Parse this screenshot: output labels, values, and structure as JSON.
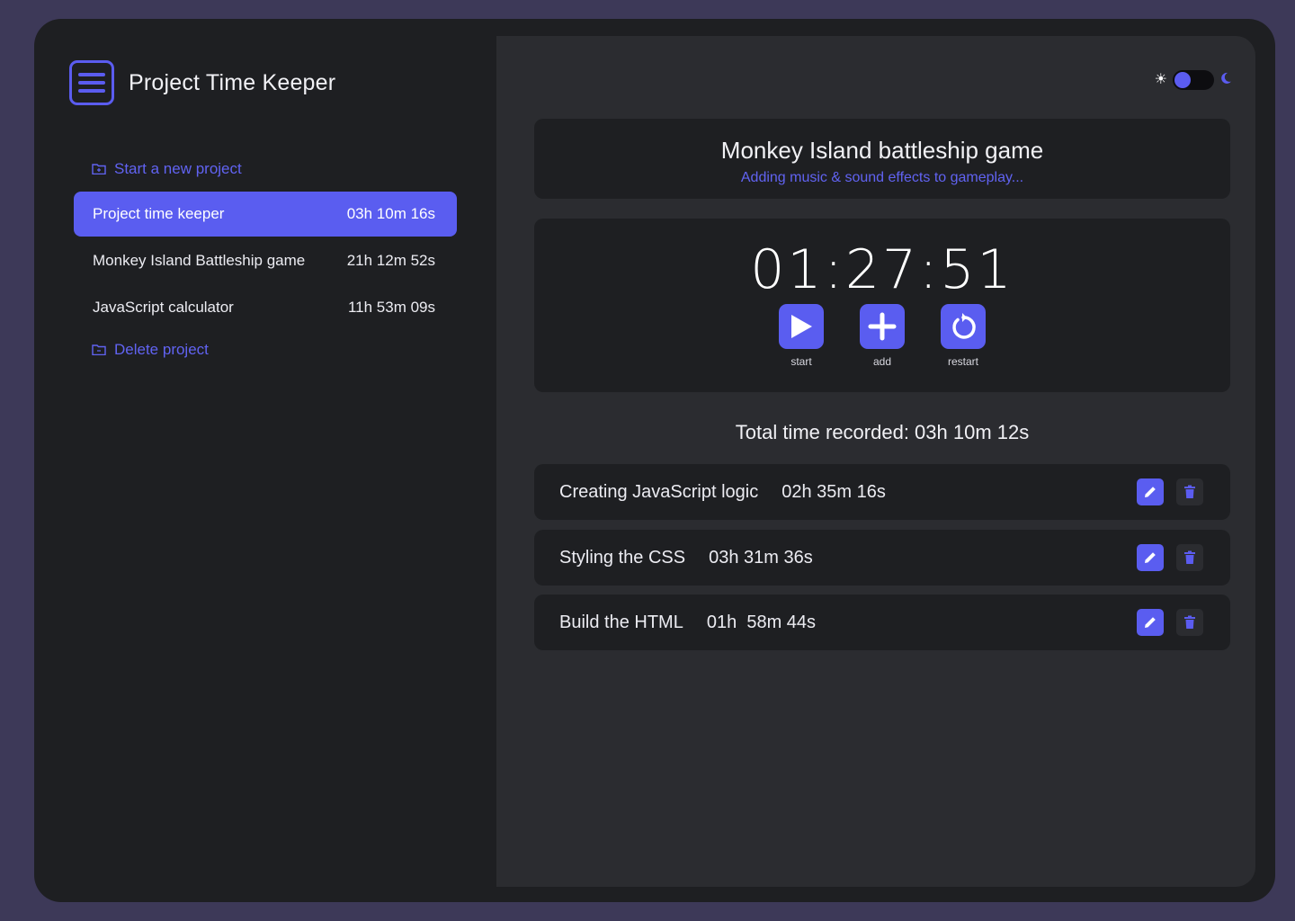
{
  "app": {
    "title": "Project Time Keeper"
  },
  "sidebar": {
    "new_project_label": "Start a new project",
    "delete_project_label": "Delete project",
    "projects": [
      {
        "name": "Project time keeper",
        "time": "03h 10m 16s",
        "active": true
      },
      {
        "name": "Monkey Island Battleship game",
        "time": "21h 12m 52s",
        "active": false
      },
      {
        "name": "JavaScript calculator",
        "time": "11h 53m 09s",
        "active": false
      }
    ]
  },
  "theme_toggle": {
    "light_icon": "sun-icon",
    "dark_icon": "moon-icon",
    "mode": "dark"
  },
  "current_project": {
    "title": "Monkey Island battleship game",
    "subtitle": "Adding music & sound effects to gameplay..."
  },
  "timer": {
    "display": "01:27:51",
    "controls": [
      {
        "label": "start",
        "icon": "play-icon"
      },
      {
        "label": "add",
        "icon": "plus-icon"
      },
      {
        "label": "restart",
        "icon": "restart-icon"
      }
    ]
  },
  "total": {
    "text": "Total time recorded: 03h 10m 12s"
  },
  "tasks": [
    {
      "name": "Creating JavaScript logic",
      "time": "02h 35m 16s"
    },
    {
      "name": "Styling the CSS",
      "time": "03h 31m 36s"
    },
    {
      "name": "Build the HTML",
      "time": "01h  58m 44s"
    }
  ],
  "colors": {
    "accent": "#5a5df0",
    "background": "#3d3958",
    "panel": "#1e1f22",
    "main": "#2b2c30"
  }
}
